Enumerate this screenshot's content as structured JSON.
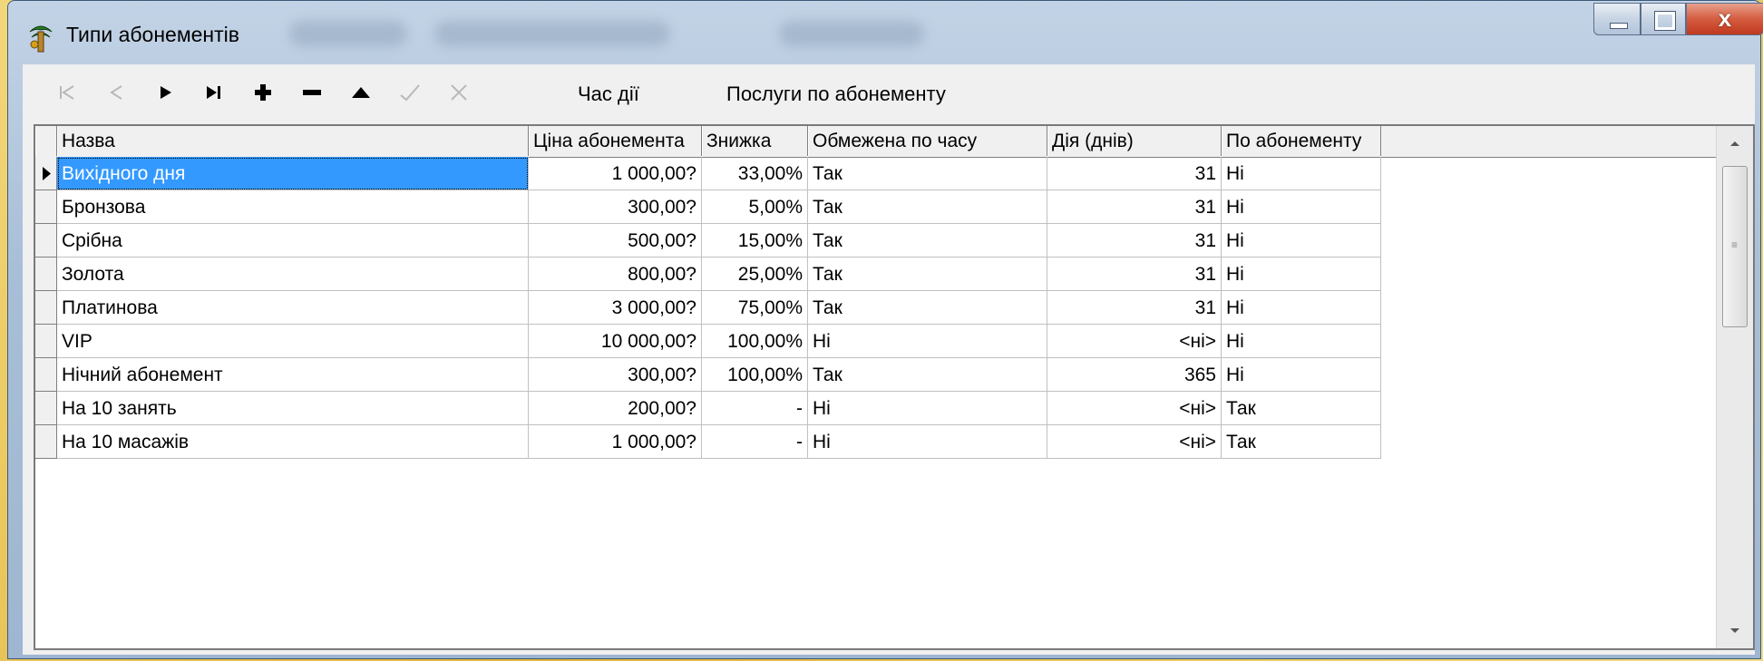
{
  "window": {
    "title": "Типи абонементів",
    "controls": {
      "minimize_icon": "minimize-icon",
      "maximize_icon": "maximize-icon",
      "close_label": "x"
    }
  },
  "toolbar": {
    "nav_buttons": [
      {
        "name": "first-record-icon",
        "enabled": false
      },
      {
        "name": "prior-record-icon",
        "enabled": false
      },
      {
        "name": "next-record-icon",
        "enabled": true
      },
      {
        "name": "last-record-icon",
        "enabled": true
      },
      {
        "name": "insert-record-icon",
        "enabled": true
      },
      {
        "name": "delete-record-icon",
        "enabled": true
      },
      {
        "name": "edit-record-icon",
        "enabled": true
      },
      {
        "name": "post-record-icon",
        "enabled": false
      },
      {
        "name": "cancel-record-icon",
        "enabled": false
      }
    ],
    "action_time_label": "Час дії",
    "services_label": "Послуги по абонементу"
  },
  "grid": {
    "columns": [
      "Назва",
      "Ціна абонемента",
      "Знижка",
      "Обмежена по часу",
      "Дія (днів)",
      "По абонементу"
    ],
    "rows": [
      [
        "Вихідного дня",
        "1 000,00?",
        "33,00%",
        "Так",
        "31",
        "Ні"
      ],
      [
        "Бронзова",
        "300,00?",
        "5,00%",
        "Так",
        "31",
        "Ні"
      ],
      [
        "Срібна",
        "500,00?",
        "15,00%",
        "Так",
        "31",
        "Ні"
      ],
      [
        "Золота",
        "800,00?",
        "25,00%",
        "Так",
        "31",
        "Ні"
      ],
      [
        "Платинова",
        "3 000,00?",
        "75,00%",
        "Так",
        "31",
        "Ні"
      ],
      [
        "VIP",
        "10 000,00?",
        "100,00%",
        "Ні",
        "<ні>",
        "Ні"
      ],
      [
        "Нічний абонемент",
        "300,00?",
        "100,00%",
        "Так",
        "365",
        "Ні"
      ],
      [
        "На 10 занять",
        "200,00?",
        "-",
        "Ні",
        "<ні>",
        "Так"
      ],
      [
        "На 10 масажів",
        "1 000,00?",
        "-",
        "Ні",
        "<ні>",
        "Так"
      ]
    ],
    "selected_row": 0
  },
  "colors": {
    "selection": "#3399ff",
    "titlebar": "#a9bfd8",
    "close": "#c0391e"
  }
}
